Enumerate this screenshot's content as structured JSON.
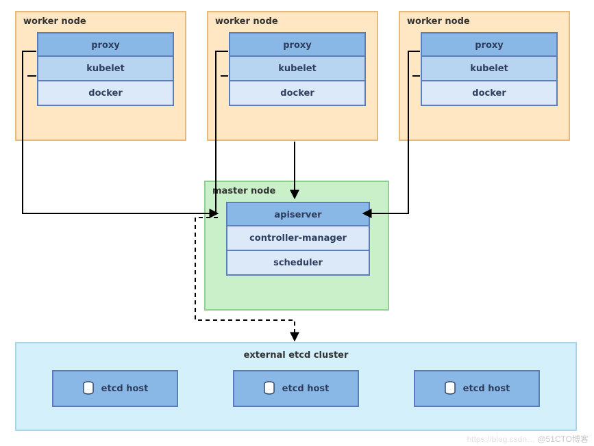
{
  "workers": [
    {
      "title": "worker node",
      "components": [
        "proxy",
        "kubelet",
        "docker"
      ]
    },
    {
      "title": "worker node",
      "components": [
        "proxy",
        "kubelet",
        "docker"
      ]
    },
    {
      "title": "worker node",
      "components": [
        "proxy",
        "kubelet",
        "docker"
      ]
    }
  ],
  "master": {
    "title": "master node",
    "components": [
      "apiserver",
      "controller-manager",
      "scheduler"
    ]
  },
  "etcd": {
    "title": "external etcd cluster",
    "hosts": [
      "etcd host",
      "etcd host",
      "etcd host"
    ]
  },
  "colors": {
    "worker_bg": "#ffe7c4",
    "master_bg": "#c9f0c9",
    "etcd_bg": "#d3f0fb",
    "comp_border": "#5b7dbb"
  },
  "watermark": {
    "faint": "https://blog.csdn…",
    "text": "@51CTO博客"
  }
}
